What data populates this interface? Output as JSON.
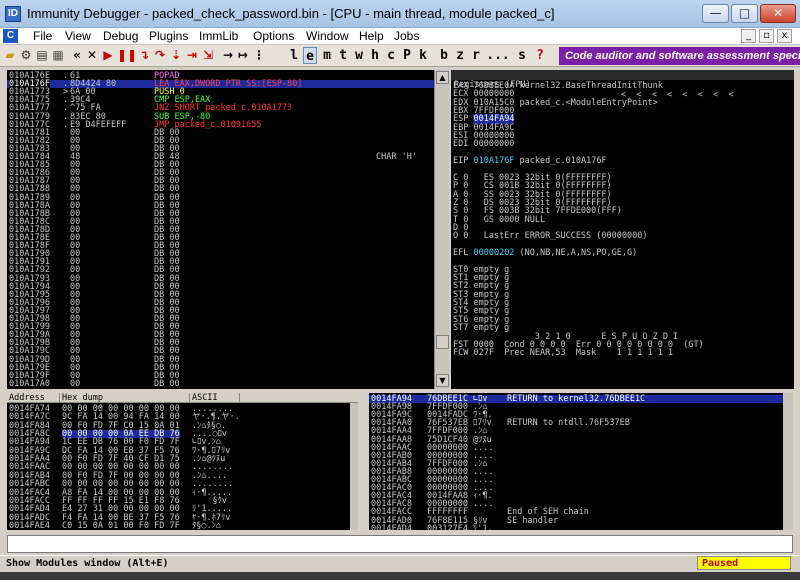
{
  "title": "Immunity Debugger - packed_check_password.bin - [CPU - main thread, module packed_c]",
  "app_icon_letter": "C",
  "window_buttons": {
    "minimize": "—",
    "maximize": "□",
    "close": "✕"
  },
  "mdi_buttons": {
    "minimize": "_",
    "restore": "▫",
    "close": "x"
  },
  "menu": [
    "File",
    "View",
    "Debug",
    "Plugins",
    "ImmLib",
    "Options",
    "Window",
    "Help",
    "Jobs"
  ],
  "toolbar_letters": [
    "l",
    "e",
    "m",
    "t",
    "w",
    "h",
    "c",
    "P",
    "k",
    "b",
    "z",
    "r",
    "...",
    "s",
    "?"
  ],
  "banner": "Code auditor and software assessment speciali",
  "cpu_rows": [
    {
      "addr": "010A176E",
      "mark": ".",
      "hex": "61",
      "dis": "POPAD",
      "com": "",
      "c": "#ff66ff"
    },
    {
      "addr": "010A176F",
      "mark": ".",
      "hex": "8D4424 80",
      "dis": "LEA EAX,DWORD PTR SS:[ESP-80]",
      "com": "",
      "c": "#ff4040",
      "sel": true
    },
    {
      "addr": "010A1773",
      "mark": ">",
      "hex": "6A 00",
      "dis": "PUSH 0",
      "com": "",
      "c": "#ffff40"
    },
    {
      "addr": "010A1775",
      "mark": ".",
      "hex": "39C4",
      "dis": "CMP ESP,EAX",
      "com": "",
      "c": "#40ff40"
    },
    {
      "addr": "010A1777",
      "mark": ".",
      "hex": "^75 FA",
      "dis": "JNZ SHORT packed_c.010A1773",
      "com": "",
      "c": "#ff3030"
    },
    {
      "addr": "010A1779",
      "mark": ".",
      "hex": "83EC 80",
      "dis": "SUB ESP,-80",
      "com": "",
      "c": "#40ff40"
    },
    {
      "addr": "010A177C",
      "mark": ".",
      "hex": "E9 D4FEFEFF",
      "dis": "JMP packed_c.01091655",
      "com": "",
      "c": "#ff3030"
    },
    {
      "addr": "010A1781",
      "mark": "",
      "hex": "00",
      "dis": "DB 00",
      "com": ""
    },
    {
      "addr": "010A1782",
      "mark": "",
      "hex": "00",
      "dis": "DB 00",
      "com": ""
    },
    {
      "addr": "010A1783",
      "mark": "",
      "hex": "00",
      "dis": "DB 00",
      "com": ""
    },
    {
      "addr": "010A1784",
      "mark": "",
      "hex": "48",
      "dis": "DB 48",
      "com": "CHAR 'H'"
    },
    {
      "addr": "010A1785",
      "mark": "",
      "hex": "00",
      "dis": "DB 00",
      "com": ""
    },
    {
      "addr": "010A1786",
      "mark": "",
      "hex": "00",
      "dis": "DB 00",
      "com": ""
    },
    {
      "addr": "010A1787",
      "mark": "",
      "hex": "00",
      "dis": "DB 00",
      "com": ""
    },
    {
      "addr": "010A1788",
      "mark": "",
      "hex": "00",
      "dis": "DB 00",
      "com": ""
    },
    {
      "addr": "010A1789",
      "mark": "",
      "hex": "00",
      "dis": "DB 00",
      "com": ""
    },
    {
      "addr": "010A178A",
      "mark": "",
      "hex": "00",
      "dis": "DB 00",
      "com": ""
    },
    {
      "addr": "010A178B",
      "mark": "",
      "hex": "00",
      "dis": "DB 00",
      "com": ""
    },
    {
      "addr": "010A178C",
      "mark": "",
      "hex": "00",
      "dis": "DB 00",
      "com": ""
    },
    {
      "addr": "010A178D",
      "mark": "",
      "hex": "00",
      "dis": "DB 00",
      "com": ""
    },
    {
      "addr": "010A178E",
      "mark": "",
      "hex": "00",
      "dis": "DB 00",
      "com": ""
    },
    {
      "addr": "010A178F",
      "mark": "",
      "hex": "00",
      "dis": "DB 00",
      "com": ""
    },
    {
      "addr": "010A1790",
      "mark": "",
      "hex": "00",
      "dis": "DB 00",
      "com": ""
    },
    {
      "addr": "010A1791",
      "mark": "",
      "hex": "00",
      "dis": "DB 00",
      "com": ""
    },
    {
      "addr": "010A1792",
      "mark": "",
      "hex": "00",
      "dis": "DB 00",
      "com": ""
    },
    {
      "addr": "010A1793",
      "mark": "",
      "hex": "00",
      "dis": "DB 00",
      "com": ""
    },
    {
      "addr": "010A1794",
      "mark": "",
      "hex": "00",
      "dis": "DB 00",
      "com": ""
    },
    {
      "addr": "010A1795",
      "mark": "",
      "hex": "00",
      "dis": "DB 00",
      "com": ""
    },
    {
      "addr": "010A1796",
      "mark": "",
      "hex": "00",
      "dis": "DB 00",
      "com": ""
    },
    {
      "addr": "010A1797",
      "mark": "",
      "hex": "00",
      "dis": "DB 00",
      "com": ""
    },
    {
      "addr": "010A1798",
      "mark": "",
      "hex": "00",
      "dis": "DB 00",
      "com": ""
    },
    {
      "addr": "010A1799",
      "mark": "",
      "hex": "00",
      "dis": "DB 00",
      "com": ""
    },
    {
      "addr": "010A179A",
      "mark": "",
      "hex": "00",
      "dis": "DB 00",
      "com": ""
    },
    {
      "addr": "010A179B",
      "mark": "",
      "hex": "00",
      "dis": "DB 00",
      "com": ""
    },
    {
      "addr": "010A179C",
      "mark": "",
      "hex": "00",
      "dis": "DB 00",
      "com": ""
    },
    {
      "addr": "010A179D",
      "mark": "",
      "hex": "00",
      "dis": "DB 00",
      "com": ""
    },
    {
      "addr": "010A179E",
      "mark": "",
      "hex": "00",
      "dis": "DB 00",
      "com": ""
    },
    {
      "addr": "010A179F",
      "mark": "",
      "hex": "00",
      "dis": "DB 00",
      "com": ""
    },
    {
      "addr": "010A17A0",
      "mark": "",
      "hex": "00",
      "dis": "DB 00",
      "com": ""
    }
  ],
  "registers": {
    "header": "Registers (FPU)",
    "header_arrows": "<  <  <  <  <  <  <  <",
    "lines": [
      "EAX 76DBEE0A kernel32.BaseThreadInitThunk",
      "ECX 00000000",
      "EDX 010A15C0 packed_c.<ModuleEntryPoint>",
      "EBX 7FFDF000",
      "ESP 0014FA94",
      "EBP 0014FA9C",
      "ESI 00000000",
      "EDI 00000000",
      "",
      "EIP 010A176F packed_c.010A176F",
      "",
      "C 0   ES 0023 32bit 0(FFFFFFFF)",
      "P 0   CS 001B 32bit 0(FFFFFFFF)",
      "A 0   SS 0023 32bit 0(FFFFFFFF)",
      "Z 0   DS 0023 32bit 0(FFFFFFFF)",
      "S 0   FS 003B 32bit 7FFDE000(FFF)",
      "T 0   GS 0000 NULL",
      "D 0",
      "O 0   LastErr ERROR_SUCCESS (00000000)",
      "",
      "EFL 00000202 (NO,NB,NE,A,NS,PO,GE,G)",
      "",
      "ST0 empty g",
      "ST1 empty g",
      "ST2 empty g",
      "ST3 empty g",
      "ST4 empty g",
      "ST5 empty g",
      "ST6 empty g",
      "ST7 empty g",
      "                3 2 1 0      E S P U O Z D I",
      "FST 0000  Cond 0 0 0 0  Err 0 0 0 0 0 0 0 0  (GT)",
      "FCW 027F  Prec NEAR,53  Mask    1 1 1 1 1 1"
    ]
  },
  "dump": {
    "headers": [
      "Address",
      "Hex dump",
      "ASCII"
    ],
    "rows": [
      {
        "addr": "0014FA74",
        "hex": "00 00 00 00 00 00 00 00",
        "ascii": "........"
      },
      {
        "addr": "0014FA7C",
        "hex": "9C FA 14 00 94 FA 14 00",
        "ascii": "ヤ·.¶.ヤ·."
      },
      {
        "addr": "0014FA84",
        "hex": "00 F0 FD 7F C0 15 0A 01",
        "ascii": ".ﾝ⌂ﾀ§○."
      },
      {
        "addr": "0014FA8C",
        "hex": "00 00 00 00 0A EE DB 76",
        "ascii": "....○ﾛv",
        "sel": true
      },
      {
        "addr": "0014FA94",
        "hex": "1C EE DB 76 00 F0 FD 7F",
        "ascii": "∟ﾛv.ﾝ⌂"
      },
      {
        "addr": "0014FA9C",
        "hex": "DC FA 14 00 EB 37 F5 76",
        "ascii": "ﾜ·¶.ﾛ7ﾘv"
      },
      {
        "addr": "0014FAA4",
        "hex": "00 F0 FD 7F 40 CF D1 75",
        "ascii": ".ﾝ⌂@ﾂﾇu"
      },
      {
        "addr": "0014FAAC",
        "hex": "00 00 00 00 00 00 00 00",
        "ascii": "........"
      },
      {
        "addr": "0014FAB4",
        "hex": "00 F0 FD 7F 00 00 00 00",
        "ascii": ".ﾝ⌂...."
      },
      {
        "addr": "0014FABC",
        "hex": "00 00 00 00 00 00 00 00",
        "ascii": "........"
      },
      {
        "addr": "0014FAC4",
        "hex": "A8 FA 14 00 00 00 00 00",
        "ascii": "ｨ·¶....."
      },
      {
        "addr": "0014FACC",
        "hex": "FF FF FF FF 15 E1 F8 76",
        "ascii": "    §ｸv"
      },
      {
        "addr": "0014FAD4",
        "hex": "E4 27 31 00 00 00 00 00",
        "ascii": "ﾘ'1....."
      },
      {
        "addr": "0014FADC",
        "hex": "F4 FA 14 00 BE 37 F5 76",
        "ascii": "ﾔ·¶.ﾎ7ﾘv"
      },
      {
        "addr": "0014FAE4",
        "hex": "C0 15 0A 01 00 F0 FD 7F",
        "ascii": "ﾀ§○.ﾝ⌂"
      }
    ]
  },
  "stack": {
    "rows": [
      {
        "addr": "0014FA94",
        "val": "76DBEE1C",
        "asc": "∟ﾛv",
        "com": "RETURN to kernel32.76DBEE1C",
        "sel": true
      },
      {
        "addr": "0014FA98",
        "val": "7FFDF000",
        "asc": ".ﾝ⌂",
        "com": ""
      },
      {
        "addr": "0014FA9C",
        "val": "0014FADC",
        "asc": "ﾜ·¶.",
        "com": ""
      },
      {
        "addr": "0014FAA0",
        "val": "76F537EB",
        "asc": "ﾛ7ﾘv",
        "com": "RETURN to ntdll.76F537EB"
      },
      {
        "addr": "0014FAA4",
        "val": "7FFDF000",
        "asc": ".ﾝ⌂",
        "com": ""
      },
      {
        "addr": "0014FAA8",
        "val": "75D1CF40",
        "asc": "@ﾂﾇu",
        "com": ""
      },
      {
        "addr": "0014FAAC",
        "val": "00000000",
        "asc": "....",
        "com": ""
      },
      {
        "addr": "0014FAB0",
        "val": "00000000",
        "asc": "....",
        "com": ""
      },
      {
        "addr": "0014FAB4",
        "val": "7FFDF000",
        "asc": ".ﾝ⌂",
        "com": ""
      },
      {
        "addr": "0014FAB8",
        "val": "00000000",
        "asc": "....",
        "com": ""
      },
      {
        "addr": "0014FABC",
        "val": "00000000",
        "asc": "....",
        "com": ""
      },
      {
        "addr": "0014FAC0",
        "val": "00000000",
        "asc": "....",
        "com": ""
      },
      {
        "addr": "0014FAC4",
        "val": "0014FAA8",
        "asc": "ｨ·¶.",
        "com": ""
      },
      {
        "addr": "0014FAC8",
        "val": "00000000",
        "asc": "....",
        "com": ""
      },
      {
        "addr": "0014FACC",
        "val": "FFFFFFFF",
        "asc": "",
        "com": "End of SEH chain"
      },
      {
        "addr": "0014FAD0",
        "val": "76F8E115",
        "asc": "§ﾘv",
        "com": "SE handler"
      },
      {
        "addr": "0014FAD4",
        "val": "003127E4",
        "asc": "ﾘ'1.",
        "com": ""
      }
    ]
  },
  "status": {
    "text": "Show Modules window (Alt+E)",
    "state": "Paused"
  },
  "colors": {
    "selection": "#1c2a9c",
    "cyan_value": "#3fd7ff",
    "banner": "#7b1fa6",
    "paused_bg": "#ffff00",
    "paused_fg": "#c00000"
  }
}
